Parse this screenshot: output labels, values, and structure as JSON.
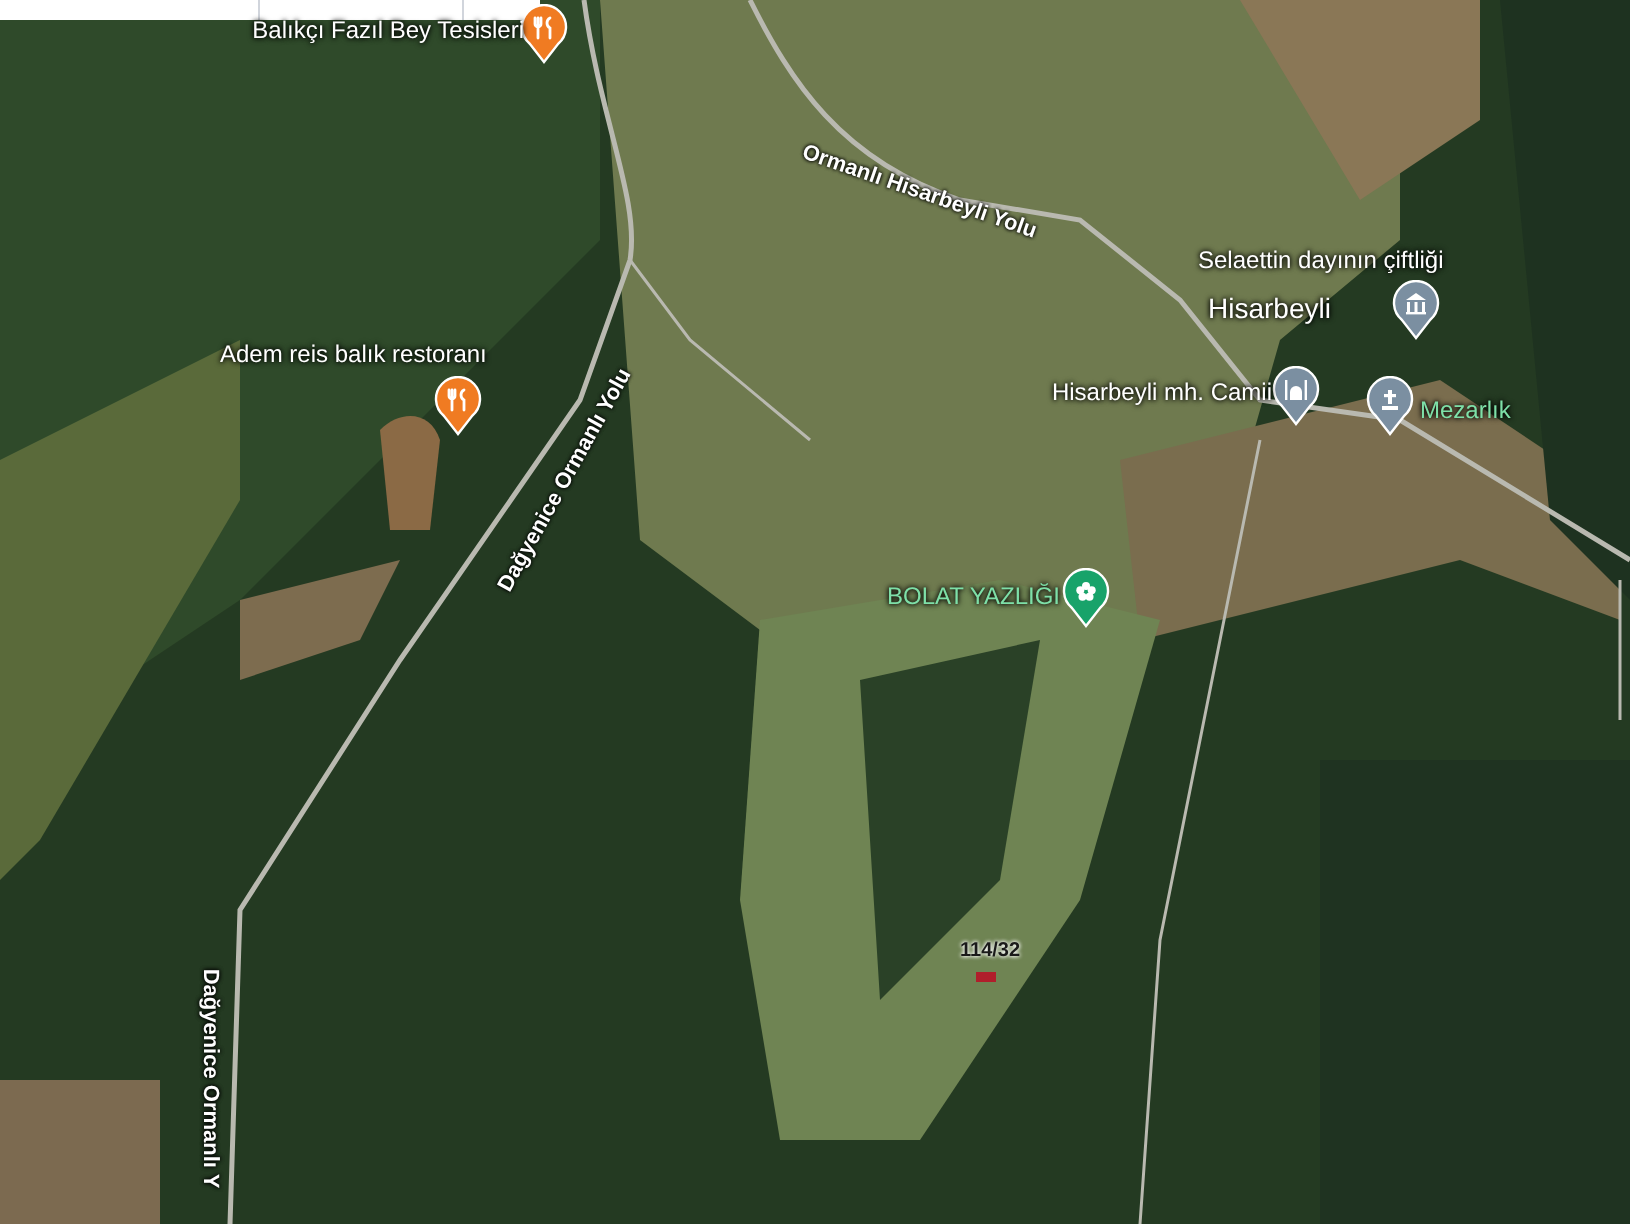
{
  "places": [
    {
      "kind": "restaurant",
      "label": "Balıkçı Fazıl Bey Tesisleri"
    },
    {
      "kind": "restaurant",
      "label": "Adem reis balık restoranı"
    },
    {
      "kind": "farm",
      "label": "Selaettin dayının çiftliği"
    },
    {
      "kind": "mosque",
      "label": "Hisarbeyli mh. Camii"
    },
    {
      "kind": "cemetery",
      "label": "Mezarlık"
    },
    {
      "kind": "park",
      "label": "BOLAT YAZLIĞI"
    }
  ],
  "village": {
    "label": "Hisarbeyli"
  },
  "roads": [
    {
      "label": "Ormanlı Hisarbeyli Yolu"
    },
    {
      "label": "Dağyenice Ormanlı Yolu"
    },
    {
      "label": "Dağyenice Ormanlı Y"
    }
  ],
  "parcel": {
    "label": "114/32"
  }
}
